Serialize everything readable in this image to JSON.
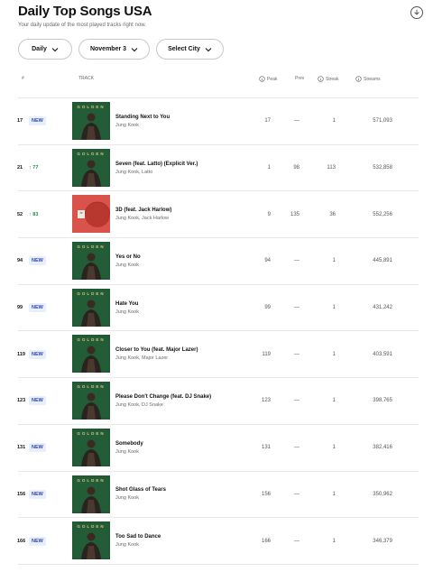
{
  "header": {
    "title": "Daily Top Songs USA",
    "subtitle": "Your daily update of the most played tracks right now.",
    "download_icon": "download-icon"
  },
  "filters": {
    "period": "Daily",
    "date": "November 3",
    "city": "Select City"
  },
  "columns": {
    "rank": "#",
    "track": "TRACK",
    "peak": "Peak",
    "prev": "Prev",
    "streak": "Streak",
    "streams": "Streams"
  },
  "colors": {
    "new_badge": "#2d46b9",
    "up_badge": "#1e8e3e",
    "golden_cover": "#1f5a35",
    "red_cover": "#d9534a"
  },
  "rows": [
    {
      "rank": "17",
      "movement": "NEW",
      "movement_type": "new",
      "cover": "golden",
      "title": "Standing Next to You",
      "artist": "Jung Kook",
      "peak": "17",
      "prev": "—",
      "streak": "1",
      "streams": "571,093"
    },
    {
      "rank": "21",
      "movement": "↑ 77",
      "movement_type": "up",
      "cover": "golden",
      "title": "Seven (feat. Latto) (Explicit Ver.)",
      "artist": "Jung Kook, Latto",
      "peak": "1",
      "prev": "98",
      "streak": "113",
      "streams": "532,858"
    },
    {
      "rank": "52",
      "movement": "↑ 83",
      "movement_type": "up",
      "cover": "red",
      "title": "3D (feat. Jack Harlow)",
      "artist": "Jung Kook, Jack Harlow",
      "peak": "9",
      "prev": "135",
      "streak": "36",
      "streams": "552,256"
    },
    {
      "rank": "94",
      "movement": "NEW",
      "movement_type": "new",
      "cover": "golden",
      "title": "Yes or No",
      "artist": "Jung Kook",
      "peak": "94",
      "prev": "—",
      "streak": "1",
      "streams": "445,891"
    },
    {
      "rank": "99",
      "movement": "NEW",
      "movement_type": "new",
      "cover": "golden",
      "title": "Hate You",
      "artist": "Jung Kook",
      "peak": "99",
      "prev": "—",
      "streak": "1",
      "streams": "431,242"
    },
    {
      "rank": "119",
      "movement": "NEW",
      "movement_type": "new",
      "cover": "golden",
      "title": "Closer to You (feat. Major Lazer)",
      "artist": "Jung Kook, Major Lazer",
      "peak": "119",
      "prev": "—",
      "streak": "1",
      "streams": "403,591"
    },
    {
      "rank": "123",
      "movement": "NEW",
      "movement_type": "new",
      "cover": "golden",
      "title": "Please Don't Change (feat. DJ Snake)",
      "artist": "Jung Kook, DJ Snake",
      "peak": "123",
      "prev": "—",
      "streak": "1",
      "streams": "398,765"
    },
    {
      "rank": "131",
      "movement": "NEW",
      "movement_type": "new",
      "cover": "golden",
      "title": "Somebody",
      "artist": "Jung Kook",
      "peak": "131",
      "prev": "—",
      "streak": "1",
      "streams": "382,416"
    },
    {
      "rank": "156",
      "movement": "NEW",
      "movement_type": "new",
      "cover": "golden",
      "title": "Shot Glass of Tears",
      "artist": "Jung Kook",
      "peak": "156",
      "prev": "—",
      "streak": "1",
      "streams": "350,962"
    },
    {
      "rank": "166",
      "movement": "NEW",
      "movement_type": "new",
      "cover": "golden",
      "title": "Too Sad to Dance",
      "artist": "Jung Kook",
      "peak": "166",
      "prev": "—",
      "streak": "1",
      "streams": "346,379"
    }
  ]
}
